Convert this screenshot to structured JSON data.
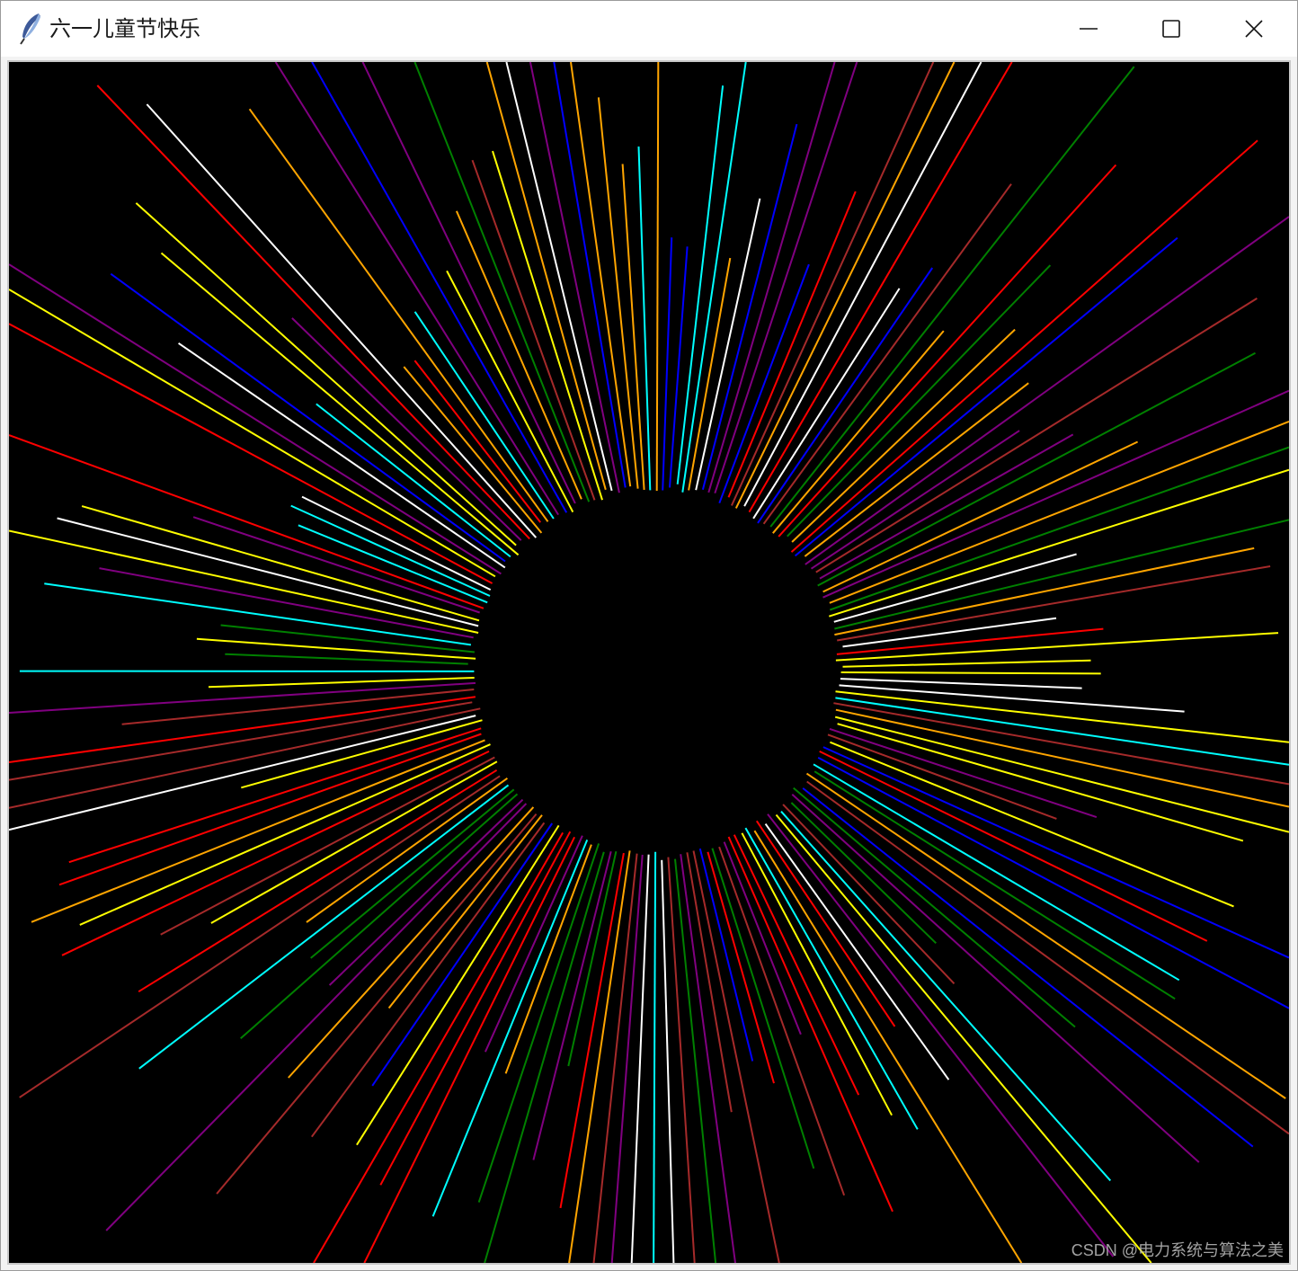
{
  "window": {
    "title": "六一儿童节快乐",
    "icon": "feather-icon",
    "controls": [
      "minimize-icon",
      "maximize-icon",
      "close-icon"
    ]
  },
  "canvas": {
    "background": "#000000",
    "ray_colors": [
      "red",
      "orange",
      "yellow",
      "green",
      "cyan",
      "blue",
      "purple",
      "white",
      "brown"
    ],
    "center_circle_color": "#000000"
  },
  "watermark": {
    "text": "CSDN @电力系统与算法之美"
  }
}
